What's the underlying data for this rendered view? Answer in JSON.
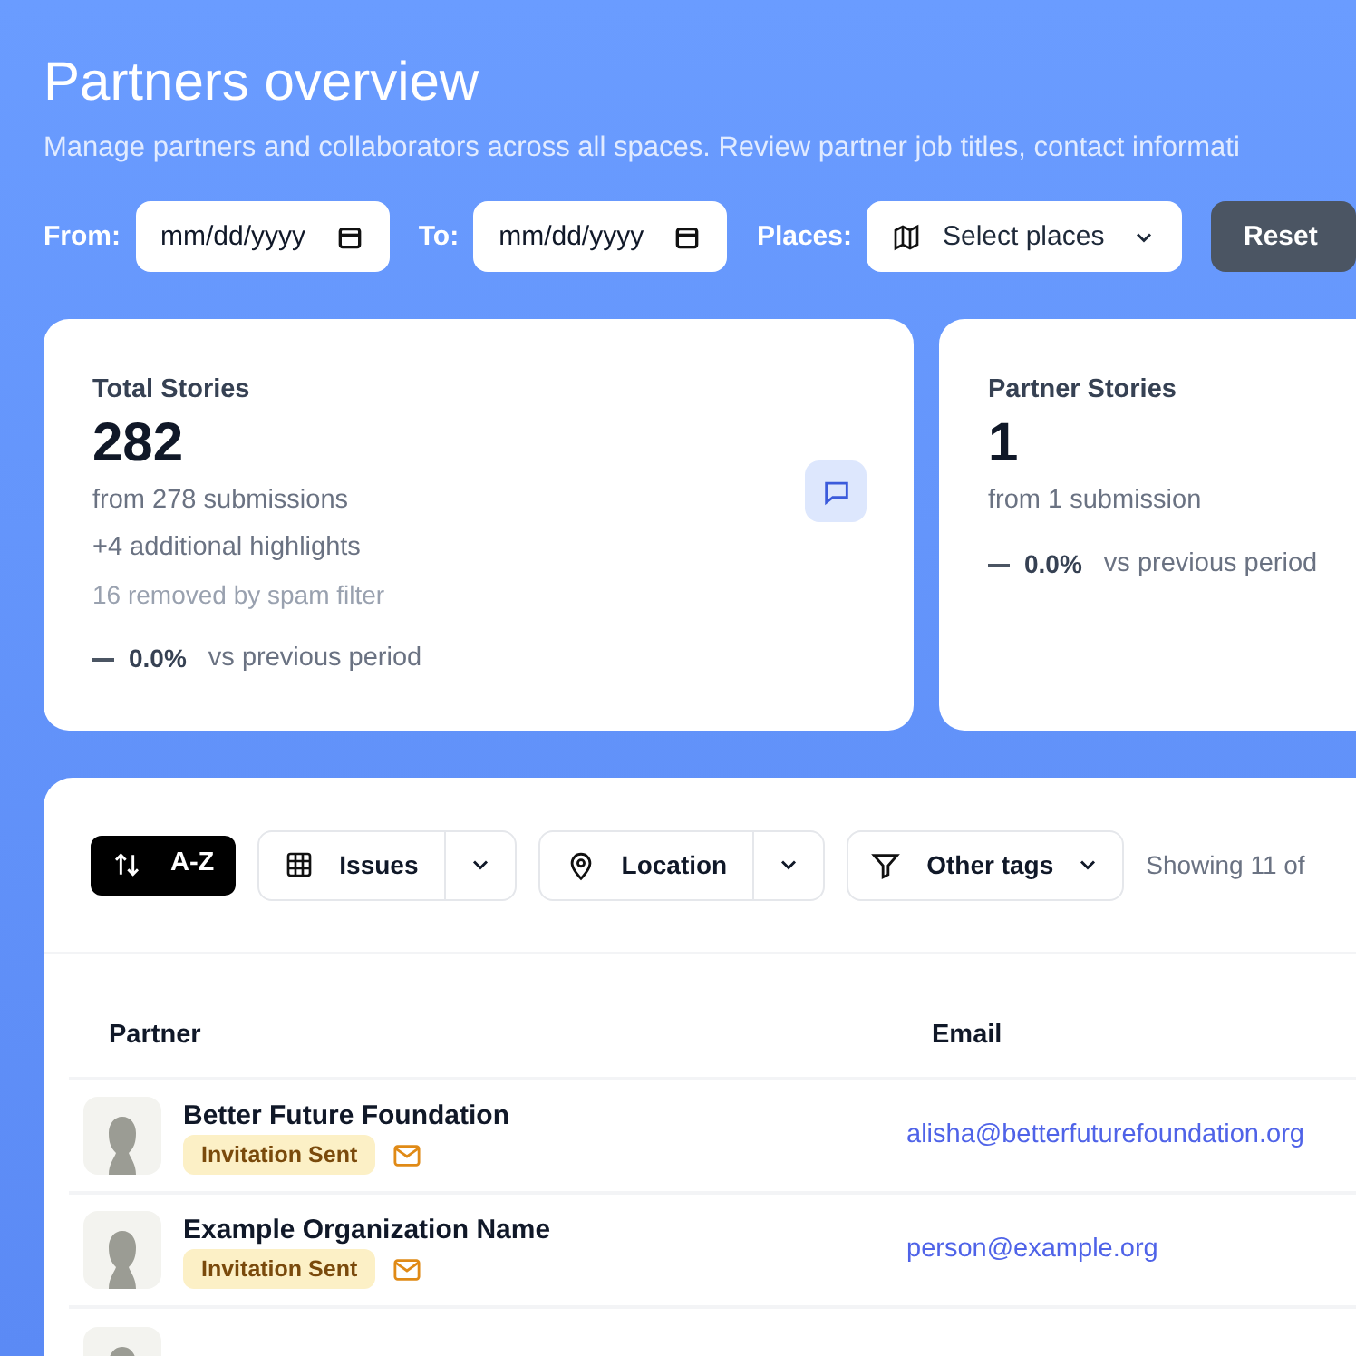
{
  "header": {
    "title": "Partners overview",
    "subtitle": "Manage partners and collaborators across all spaces. Review partner job titles, contact informati"
  },
  "filters": {
    "from_label": "From:",
    "from_placeholder": "mm/dd/yyyy",
    "to_label": "To:",
    "to_placeholder": "mm/dd/yyyy",
    "places_label": "Places:",
    "places_select": "Select places",
    "reset": "Reset"
  },
  "stats": [
    {
      "title": "Total Stories",
      "value": "282",
      "lines": [
        "from 278 submissions",
        "+4 additional highlights"
      ],
      "note": "16 removed by spam filter",
      "change": "0.0%",
      "comparison": "vs previous period",
      "has_icon": true
    },
    {
      "title": "Partner Stories",
      "value": "1",
      "lines": [
        "from 1 submission"
      ],
      "change": "0.0%",
      "comparison": "vs previous period",
      "has_icon": false
    }
  ],
  "toolbar": {
    "sort": "A-Z",
    "filters": [
      {
        "kind": "split",
        "label": "Issues"
      },
      {
        "kind": "split",
        "label": "Location"
      },
      {
        "kind": "dropdown",
        "label": "Other tags"
      }
    ],
    "showing": "Showing 11 of"
  },
  "table": {
    "columns": [
      "Partner",
      "Email"
    ],
    "rows": [
      {
        "name": "Better Future Foundation",
        "status": "Invitation Sent",
        "email": "alisha@betterfuturefoundation.org"
      },
      {
        "name": "Example Organization Name",
        "status": "Invitation Sent",
        "email": "person@example.org"
      }
    ]
  }
}
